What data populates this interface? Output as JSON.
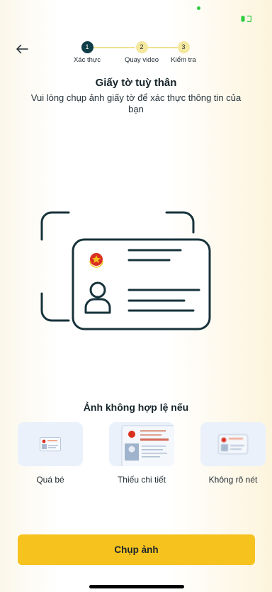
{
  "colors": {
    "accent": "#f6c21e",
    "primary_dark": "#0f3d48",
    "step_inactive": "#f4e79e",
    "card_bg": "#eaf1fb",
    "status_green": "#2ecc40"
  },
  "header": {
    "back_icon": "arrow-left-icon"
  },
  "stepper": {
    "steps": [
      {
        "number": "1",
        "label": "Xác thực",
        "active": true
      },
      {
        "number": "2",
        "label": "Quay video",
        "active": false
      },
      {
        "number": "3",
        "label": "Kiểm tra",
        "active": false
      }
    ]
  },
  "main": {
    "title": "Giấy tờ tuỳ thân",
    "subtitle": "Vui lòng chụp ảnh giấy tờ để xác thực thông tin của bạn",
    "illustration_icon": "id-card-scan-icon"
  },
  "invalid": {
    "heading": "Ảnh không hợp lệ nếu",
    "examples": [
      {
        "label": "Quá bé",
        "icon": "small-id-card-icon"
      },
      {
        "label": "Thiếu chi tiết",
        "icon": "cropped-id-card-icon"
      },
      {
        "label": "Không rõ nét",
        "icon": "blurry-id-card-icon"
      }
    ]
  },
  "actions": {
    "capture_label": "Chụp ảnh"
  }
}
